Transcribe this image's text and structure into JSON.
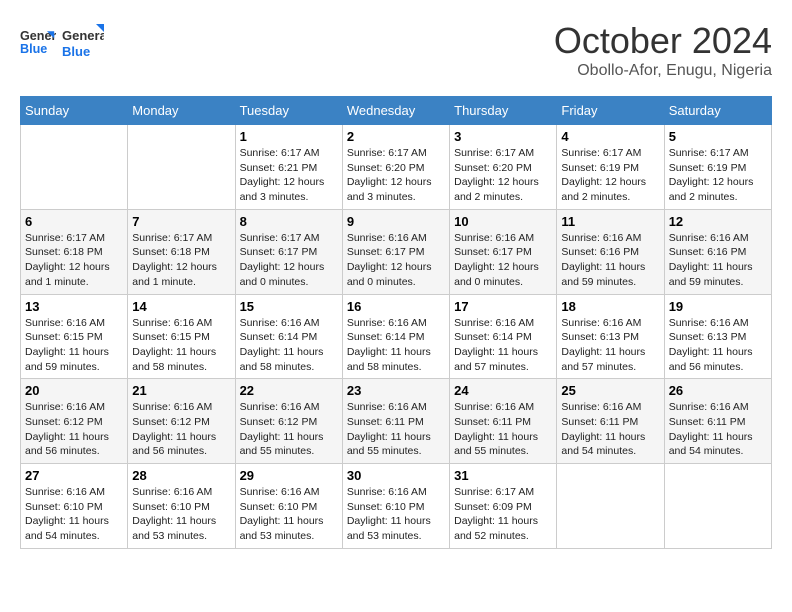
{
  "logo": {
    "line1": "General",
    "line2": "Blue"
  },
  "title": "October 2024",
  "location": "Obollo-Afor, Enugu, Nigeria",
  "weekdays": [
    "Sunday",
    "Monday",
    "Tuesday",
    "Wednesday",
    "Thursday",
    "Friday",
    "Saturday"
  ],
  "weeks": [
    [
      null,
      null,
      {
        "day": 1,
        "sunrise": "6:17 AM",
        "sunset": "6:21 PM",
        "daylight": "12 hours and 3 minutes."
      },
      {
        "day": 2,
        "sunrise": "6:17 AM",
        "sunset": "6:20 PM",
        "daylight": "12 hours and 3 minutes."
      },
      {
        "day": 3,
        "sunrise": "6:17 AM",
        "sunset": "6:20 PM",
        "daylight": "12 hours and 2 minutes."
      },
      {
        "day": 4,
        "sunrise": "6:17 AM",
        "sunset": "6:19 PM",
        "daylight": "12 hours and 2 minutes."
      },
      {
        "day": 5,
        "sunrise": "6:17 AM",
        "sunset": "6:19 PM",
        "daylight": "12 hours and 2 minutes."
      }
    ],
    [
      {
        "day": 6,
        "sunrise": "6:17 AM",
        "sunset": "6:18 PM",
        "daylight": "12 hours and 1 minute."
      },
      {
        "day": 7,
        "sunrise": "6:17 AM",
        "sunset": "6:18 PM",
        "daylight": "12 hours and 1 minute."
      },
      {
        "day": 8,
        "sunrise": "6:17 AM",
        "sunset": "6:17 PM",
        "daylight": "12 hours and 0 minutes."
      },
      {
        "day": 9,
        "sunrise": "6:16 AM",
        "sunset": "6:17 PM",
        "daylight": "12 hours and 0 minutes."
      },
      {
        "day": 10,
        "sunrise": "6:16 AM",
        "sunset": "6:17 PM",
        "daylight": "12 hours and 0 minutes."
      },
      {
        "day": 11,
        "sunrise": "6:16 AM",
        "sunset": "6:16 PM",
        "daylight": "11 hours and 59 minutes."
      },
      {
        "day": 12,
        "sunrise": "6:16 AM",
        "sunset": "6:16 PM",
        "daylight": "11 hours and 59 minutes."
      }
    ],
    [
      {
        "day": 13,
        "sunrise": "6:16 AM",
        "sunset": "6:15 PM",
        "daylight": "11 hours and 59 minutes."
      },
      {
        "day": 14,
        "sunrise": "6:16 AM",
        "sunset": "6:15 PM",
        "daylight": "11 hours and 58 minutes."
      },
      {
        "day": 15,
        "sunrise": "6:16 AM",
        "sunset": "6:14 PM",
        "daylight": "11 hours and 58 minutes."
      },
      {
        "day": 16,
        "sunrise": "6:16 AM",
        "sunset": "6:14 PM",
        "daylight": "11 hours and 58 minutes."
      },
      {
        "day": 17,
        "sunrise": "6:16 AM",
        "sunset": "6:14 PM",
        "daylight": "11 hours and 57 minutes."
      },
      {
        "day": 18,
        "sunrise": "6:16 AM",
        "sunset": "6:13 PM",
        "daylight": "11 hours and 57 minutes."
      },
      {
        "day": 19,
        "sunrise": "6:16 AM",
        "sunset": "6:13 PM",
        "daylight": "11 hours and 56 minutes."
      }
    ],
    [
      {
        "day": 20,
        "sunrise": "6:16 AM",
        "sunset": "6:12 PM",
        "daylight": "11 hours and 56 minutes."
      },
      {
        "day": 21,
        "sunrise": "6:16 AM",
        "sunset": "6:12 PM",
        "daylight": "11 hours and 56 minutes."
      },
      {
        "day": 22,
        "sunrise": "6:16 AM",
        "sunset": "6:12 PM",
        "daylight": "11 hours and 55 minutes."
      },
      {
        "day": 23,
        "sunrise": "6:16 AM",
        "sunset": "6:11 PM",
        "daylight": "11 hours and 55 minutes."
      },
      {
        "day": 24,
        "sunrise": "6:16 AM",
        "sunset": "6:11 PM",
        "daylight": "11 hours and 55 minutes."
      },
      {
        "day": 25,
        "sunrise": "6:16 AM",
        "sunset": "6:11 PM",
        "daylight": "11 hours and 54 minutes."
      },
      {
        "day": 26,
        "sunrise": "6:16 AM",
        "sunset": "6:11 PM",
        "daylight": "11 hours and 54 minutes."
      }
    ],
    [
      {
        "day": 27,
        "sunrise": "6:16 AM",
        "sunset": "6:10 PM",
        "daylight": "11 hours and 54 minutes."
      },
      {
        "day": 28,
        "sunrise": "6:16 AM",
        "sunset": "6:10 PM",
        "daylight": "11 hours and 53 minutes."
      },
      {
        "day": 29,
        "sunrise": "6:16 AM",
        "sunset": "6:10 PM",
        "daylight": "11 hours and 53 minutes."
      },
      {
        "day": 30,
        "sunrise": "6:16 AM",
        "sunset": "6:10 PM",
        "daylight": "11 hours and 53 minutes."
      },
      {
        "day": 31,
        "sunrise": "6:17 AM",
        "sunset": "6:09 PM",
        "daylight": "11 hours and 52 minutes."
      },
      null,
      null
    ]
  ]
}
